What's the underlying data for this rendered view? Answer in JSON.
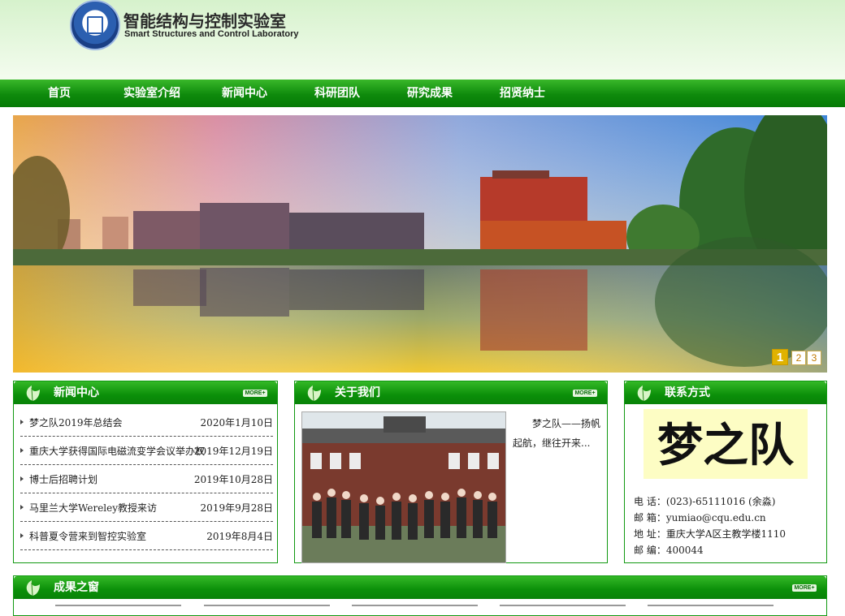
{
  "header": {
    "logo_icon": "university-seal-icon",
    "title_cn": "智能结构与控制实验室",
    "title_en": "Smart Structures and Control Laboratory"
  },
  "nav": {
    "items": [
      {
        "label": "首页"
      },
      {
        "label": "实验室介绍"
      },
      {
        "label": "新闻中心"
      },
      {
        "label": "科研团队"
      },
      {
        "label": "研究成果"
      },
      {
        "label": "招贤纳士"
      }
    ]
  },
  "banner": {
    "pages": [
      "1",
      "2",
      "3"
    ],
    "active_page": "1"
  },
  "news": {
    "title": "新闻中心",
    "more": "MORE+",
    "items": [
      {
        "title": "梦之队2019年总结会",
        "date": "2020年1月10日"
      },
      {
        "title": "重庆大学获得国际电磁流变学会议举办权",
        "date": "2019年12月19日"
      },
      {
        "title": "博士后招聘计划",
        "date": "2019年10月28日"
      },
      {
        "title": "马里兰大学Wereley教授来访",
        "date": "2019年9月28日"
      },
      {
        "title": "科普夏令营来到智控实验室",
        "date": "2019年8月4日"
      }
    ]
  },
  "about": {
    "title": "关于我们",
    "more": "MORE+",
    "text_line1": "梦之队——扬帆",
    "text_line2": "起航，继往开来..."
  },
  "contact": {
    "title": "联系方式",
    "signature_text": "梦之队",
    "phone": "电 话：(023)-65111016 (余淼)",
    "email": "邮 箱：yumiao@cqu.edu.cn",
    "address": "地 址：重庆大学A区主教学楼1110",
    "postcode": "邮 编：400044"
  },
  "results": {
    "title": "成果之窗",
    "more": "MORE+"
  },
  "colors": {
    "nav_green": "#0e8a0c",
    "header_bg": "#e6f7dc",
    "accent_gold": "#e0b200"
  }
}
